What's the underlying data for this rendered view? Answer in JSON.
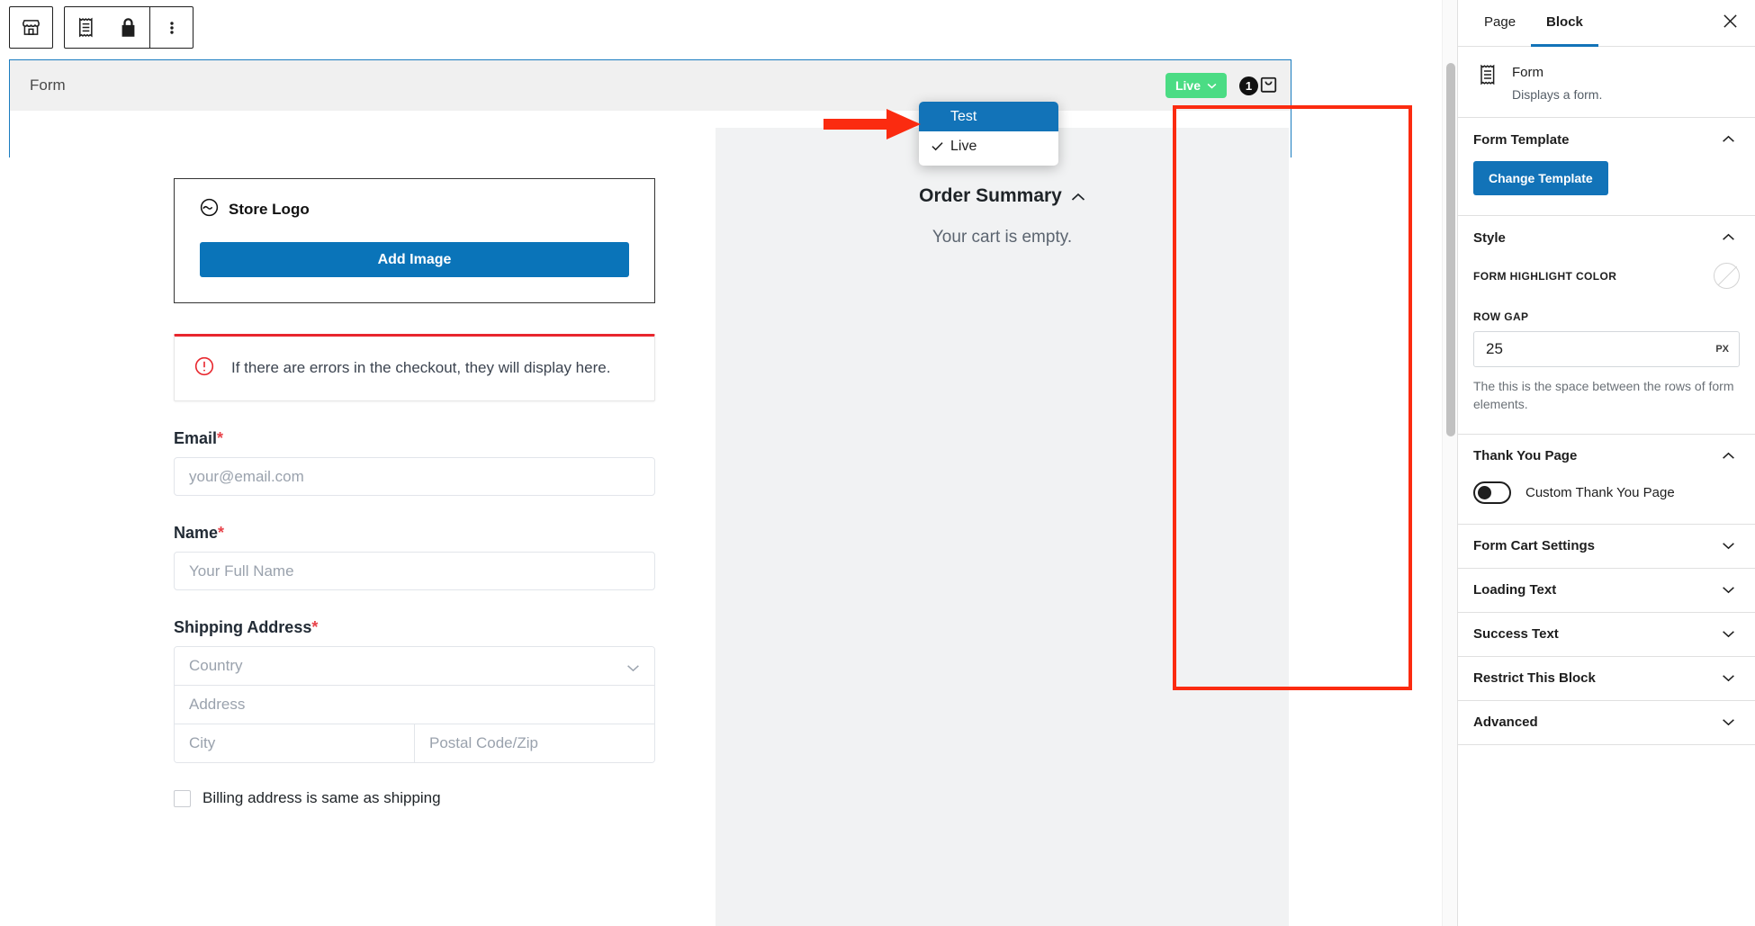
{
  "toolbar": {
    "store_button": "store-icon",
    "receipt_button": "receipt-icon",
    "lock_button": "lock-icon",
    "more_button": "more-options-icon"
  },
  "block": {
    "title": "Form",
    "live_label": "Live",
    "cart_count": "1"
  },
  "mode_menu": {
    "items": [
      {
        "label": "Test",
        "checked": false,
        "active": true
      },
      {
        "label": "Live",
        "checked": true,
        "active": false
      }
    ]
  },
  "order_summary": {
    "title": "Order Summary",
    "empty_text": "Your cart is empty."
  },
  "form": {
    "logo_card": {
      "label": "Store Logo",
      "button": "Add Image"
    },
    "notice": {
      "text": "If there are errors in the checkout, they will display here."
    },
    "fields": [
      {
        "label": "Email",
        "required": "*",
        "placeholder": "your@email.com"
      },
      {
        "label": "Name",
        "required": "*",
        "placeholder": "Your Full Name"
      }
    ],
    "shipping": {
      "label": "Shipping Address",
      "required": "*",
      "country_placeholder": "Country",
      "address_placeholder": "Address",
      "city_placeholder": "City",
      "postal_placeholder": "Postal Code/Zip"
    },
    "billing_checkbox_label": "Billing address is same as shipping"
  },
  "sidebar": {
    "tabs": [
      {
        "label": "Page",
        "active": false
      },
      {
        "label": "Block",
        "active": true
      }
    ],
    "block_info": {
      "name": "Form",
      "description": "Displays a form."
    },
    "panels": [
      {
        "title": "Form Template",
        "expanded": true
      },
      {
        "title": "Style",
        "expanded": true
      },
      {
        "title": "Thank You Page",
        "expanded": true
      },
      {
        "title": "Form Cart Settings",
        "expanded": false
      },
      {
        "title": "Loading Text",
        "expanded": false
      },
      {
        "title": "Success Text",
        "expanded": false
      },
      {
        "title": "Restrict This Block",
        "expanded": false
      },
      {
        "title": "Advanced",
        "expanded": false
      }
    ],
    "form_template": {
      "change_button": "Change Template"
    },
    "style": {
      "highlight_color_label": "FORM HIGHLIGHT COLOR",
      "row_gap_label": "ROW GAP",
      "row_gap_value": "25",
      "row_gap_unit": "PX",
      "row_gap_help": "The this is the space between the rows of form elements."
    },
    "thank_you": {
      "toggle_label": "Custom Thank You Page"
    }
  },
  "colors": {
    "accent_blue": "#1273b8",
    "live_green": "#4bdc84",
    "error_red": "#e8262d",
    "annotation_red": "#fb2b10",
    "selection_blue": "#1a7cc0"
  }
}
